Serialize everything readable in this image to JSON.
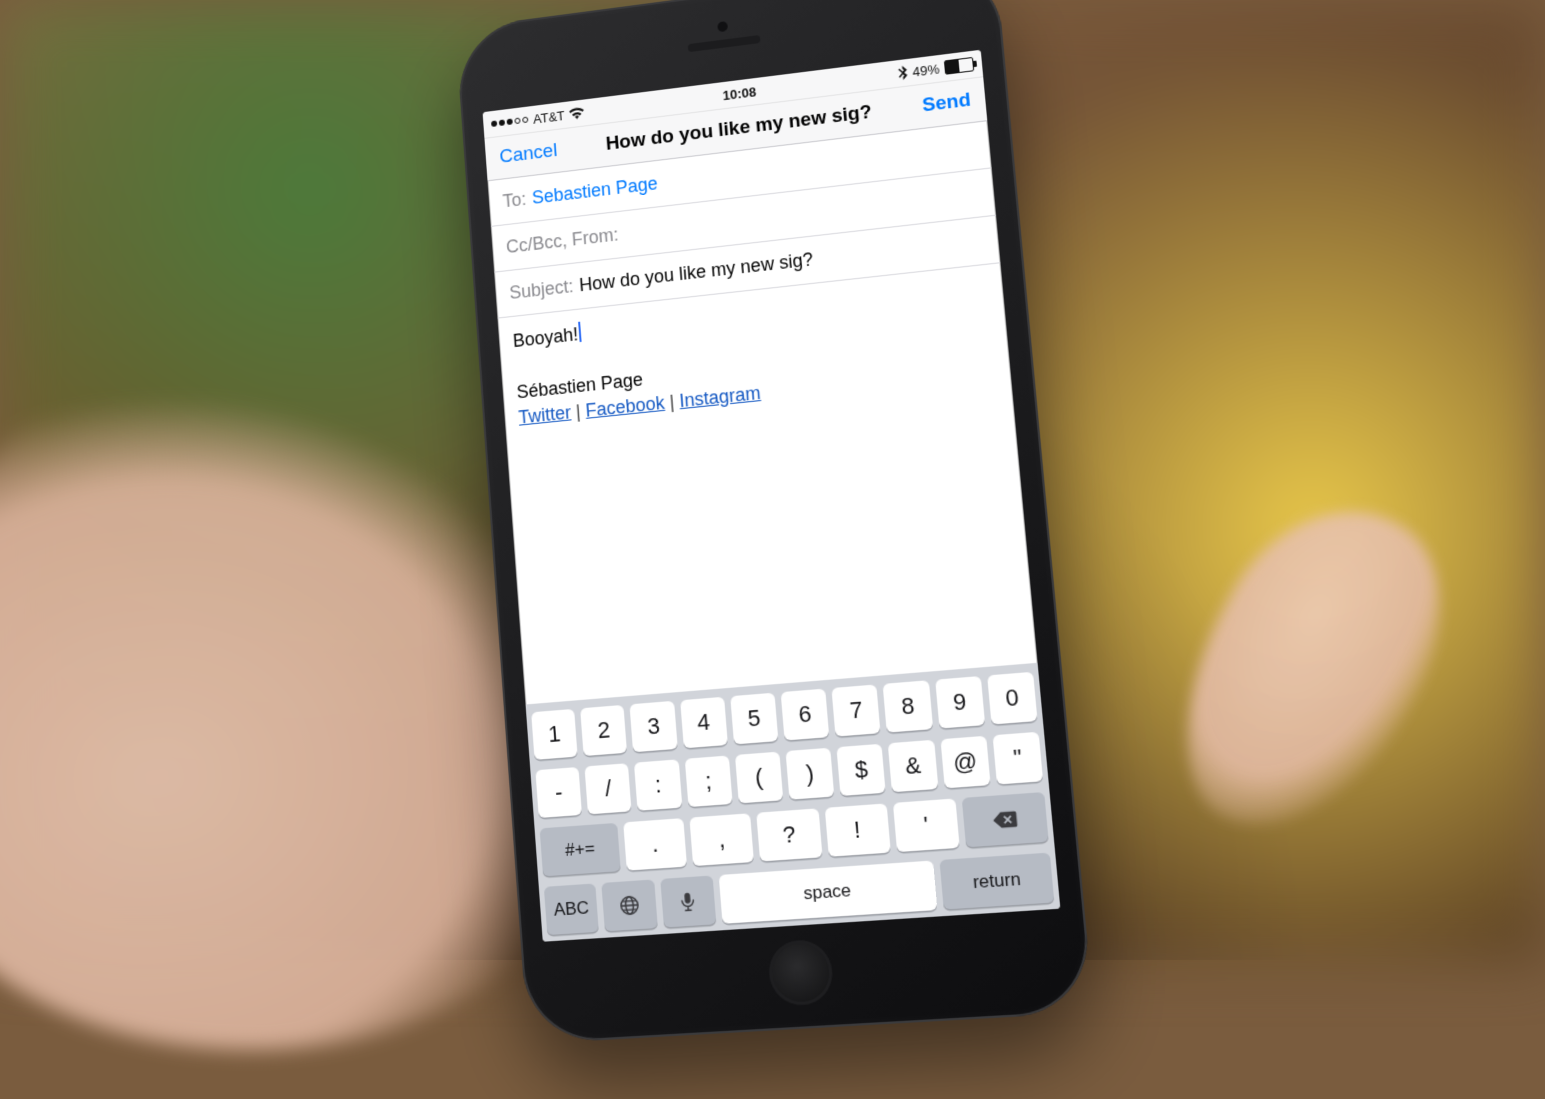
{
  "status": {
    "carrier": "AT&T",
    "time": "10:08",
    "battery_pct": "49%"
  },
  "nav": {
    "cancel": "Cancel",
    "title": "How do you like my new sig?",
    "send": "Send"
  },
  "compose": {
    "to_label": "To:",
    "to_value": "Sebastien Page",
    "cc_label": "Cc/Bcc, From:",
    "subject_label": "Subject:",
    "subject_value": "How do you like my new sig?",
    "body_text": "Booyah!",
    "signature_name": "Sébastien Page",
    "sig_link1": "Twitter",
    "sig_link2": "Facebook",
    "sig_link3": "Instagram",
    "sig_sep": " | "
  },
  "keyboard": {
    "row1": [
      "1",
      "2",
      "3",
      "4",
      "5",
      "6",
      "7",
      "8",
      "9",
      "0"
    ],
    "row2": [
      "-",
      "/",
      ":",
      ";",
      "(",
      ")",
      "$",
      "&",
      "@",
      "\""
    ],
    "row3_shift": "#+=",
    "row3": [
      ".",
      ",",
      "?",
      "!",
      "'"
    ],
    "row4_abc": "ABC",
    "space": "space",
    "ret": "return"
  }
}
